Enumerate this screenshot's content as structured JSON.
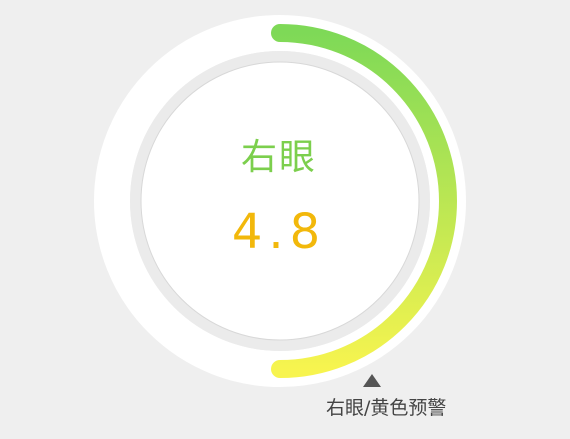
{
  "eye": {
    "label": "右眼",
    "value": "4.8"
  },
  "status": {
    "text": "右眼/黄色预警"
  },
  "colors": {
    "background": "#efefef",
    "outer_track": "#ffffff",
    "inner_ring": "#ebebeb",
    "center_fill": "#ffffff",
    "arc_start": "#7ed957",
    "arc_end": "#f7f44f",
    "label": "#7ccf4d",
    "value": "#f2b80b",
    "status_text": "#444444",
    "marker": "#555555"
  },
  "icons": {
    "marker": "triangle-up-icon"
  }
}
